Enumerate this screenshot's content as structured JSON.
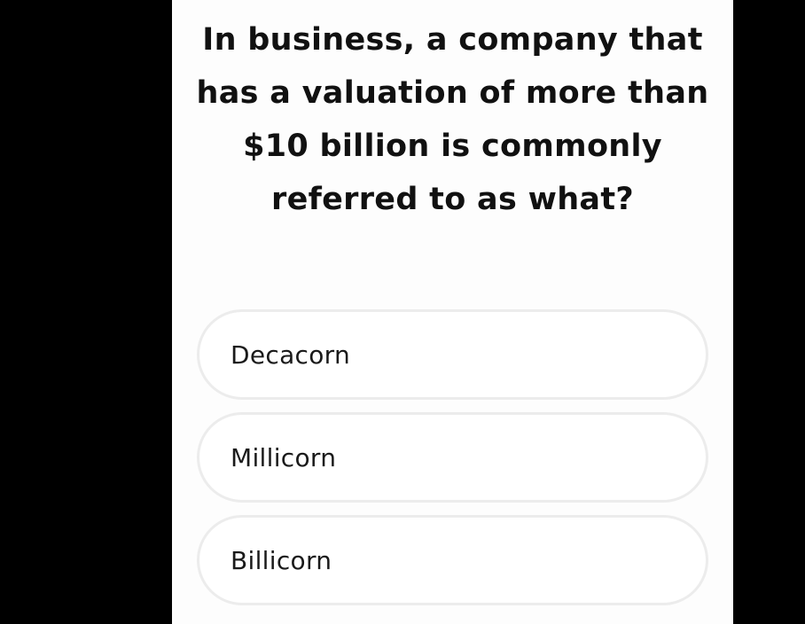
{
  "quiz": {
    "question": "In business, a company that has a valuation of more than $10 billion is commonly referred to as what?",
    "options": [
      {
        "label": "Decacorn"
      },
      {
        "label": "Millicorn"
      },
      {
        "label": "Billicorn"
      }
    ]
  },
  "colors": {
    "background": "#000000",
    "card": "#fdfdfd",
    "option_border": "#ececec",
    "text": "#111111"
  }
}
